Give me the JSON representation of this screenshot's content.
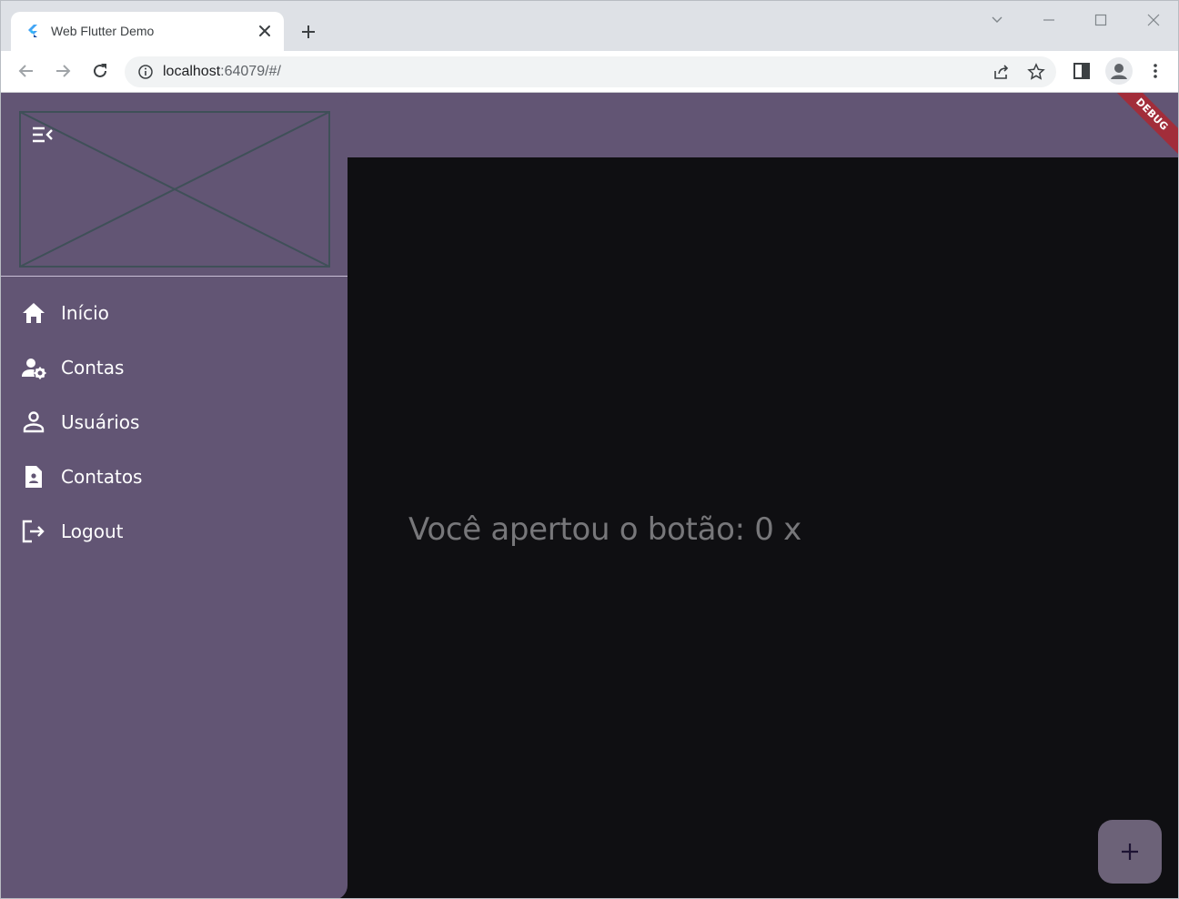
{
  "browser": {
    "tab_title": "Web Flutter Demo",
    "url_host": "localhost",
    "url_rest": ":64079/#/"
  },
  "app": {
    "debug_label": "DEBUG",
    "counter_text": "Você apertou o botão: 0 x",
    "fab_icon": "plus-icon"
  },
  "drawer": {
    "items": [
      {
        "label": "Início",
        "icon": "home-icon"
      },
      {
        "label": "Contas",
        "icon": "user-settings-icon"
      },
      {
        "label": "Usuários",
        "icon": "person-icon"
      },
      {
        "label": "Contatos",
        "icon": "contact-document-icon"
      },
      {
        "label": "Logout",
        "icon": "logout-icon"
      }
    ]
  },
  "colors": {
    "drawer_bg": "#625574",
    "app_bg": "#0f0f12",
    "debug_banner": "#a22d3a",
    "fab_bg": "#6c6278"
  }
}
